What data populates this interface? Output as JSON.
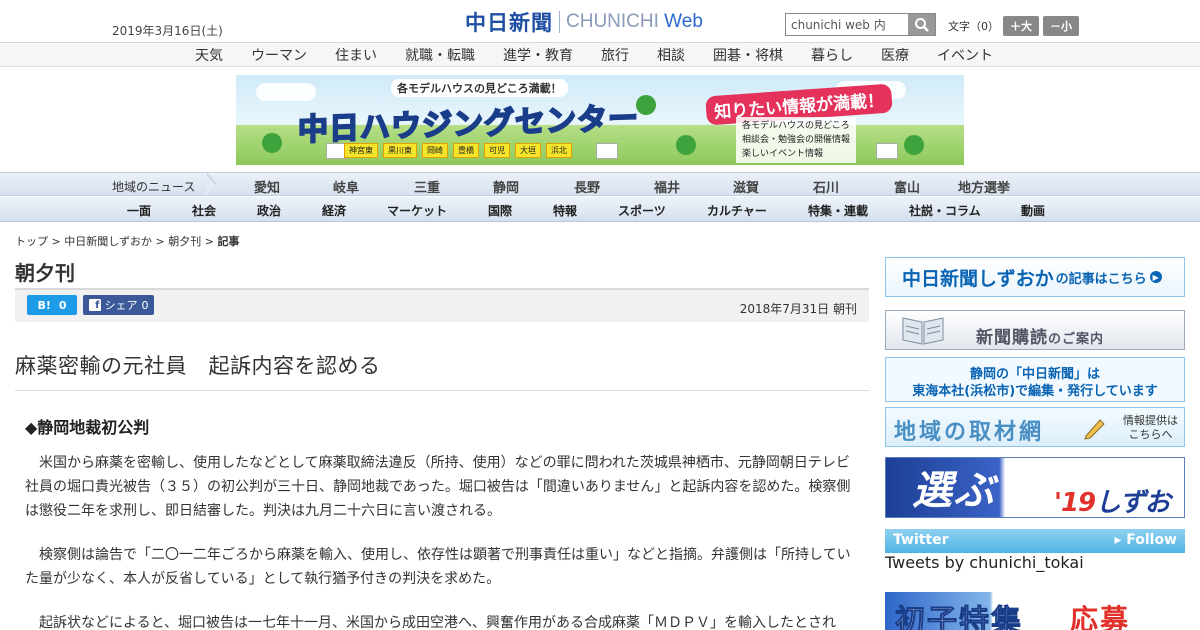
{
  "header": {
    "date": "2019年3月16日(土)",
    "logo_jp": "中日新聞",
    "logo_en": "CHUNICHI",
    "logo_web": "Web",
    "search_value": "chunichi web 内",
    "font_label": "文字（0）",
    "font_plus": "＋大",
    "font_minus": "－小"
  },
  "category_nav": [
    "天気",
    "ウーマン",
    "住まい",
    "就職・転職",
    "進学・教育",
    "旅行",
    "相談",
    "囲碁・将棋",
    "暮らし",
    "医療",
    "イベント"
  ],
  "banner": {
    "top_text": "各モデルハウスの見どころ満載！",
    "title": "中日ハウジングセンター",
    "right_text": "知りたい情報が満載！",
    "list": [
      "各モデルハウスの見どころ",
      "相談会・勉強会の開催情報",
      "楽しいイベント情報"
    ],
    "cities": [
      "神宮東",
      "黒川東",
      "岡崎",
      "豊橋",
      "可児",
      "大垣",
      "浜北"
    ]
  },
  "region_nav": {
    "label": "地域のニュース",
    "items": [
      "愛知",
      "岐阜",
      "三重",
      "静岡",
      "長野",
      "福井",
      "滋賀",
      "石川",
      "富山",
      "地方選挙"
    ]
  },
  "section_nav": [
    "一面",
    "社会",
    "政治",
    "経済",
    "マーケット",
    "国際",
    "特報",
    "スポーツ",
    "カルチャー",
    "特集・連載",
    "社説・コラム",
    "動画"
  ],
  "breadcrumb": {
    "items": [
      "トップ",
      "中日新聞しずおか",
      "朝夕刊"
    ],
    "current": "記事",
    "sep": " > "
  },
  "article": {
    "section_title": "朝夕刊",
    "hatena_label": "B!",
    "hatena_count": "0",
    "fb_label": "シェア",
    "fb_count": "0",
    "pub_date": "2018年7月31日 朝刊",
    "headline": "麻薬密輸の元社員　起訴内容を認める",
    "subhead": "◆静岡地裁初公判",
    "paragraphs": [
      "米国から麻薬を密輸し、使用したなどとして麻薬取締法違反（所持、使用）などの罪に問われた茨城県神栖市、元静岡朝日テレビ社員の堀口貴光被告（３５）の初公判が三十日、静岡地裁であった。堀口被告は「間違いありません」と起訴内容を認めた。検察側は懲役二年を求刑し、即日結審した。判決は九月二十六日に言い渡される。",
      "検察側は論告で「二〇一二年ごろから麻薬を輸入、使用し、依存性は顕著で刑事責任は重い」などと指摘。弁護側は「所持していた量が少なく、本人が反省している」として執行猶予付きの判決を求めた。",
      "起訴状などによると、堀口被告は一七年十一月、米国から成田空港へ、興奮作用がある合成麻薬「ＭＤＰＶ」を輸入したとされ"
    ]
  },
  "sidebar": {
    "shizuoka_main": "中日新聞しずおか",
    "shizuoka_tail": "の記事はこちら",
    "subscribe_main": "新聞購読",
    "subscribe_tail": "のご案内",
    "tokai_line1": "静岡の「中日新聞」は",
    "tokai_line2": "東海本社(浜松市)で編集・発行しています",
    "network_title": "地域の取材網",
    "network_sub1": "情報提供は",
    "network_sub2": "こちらへ",
    "election_big": "選ぶ",
    "election_year": "'19",
    "election_place": "しずおか",
    "twitter_label": "Twitter",
    "twitter_follow": "▸ Follow",
    "tweets_by": "Tweets by chunichi_tokai",
    "bottom_ad": "初子特集",
    "bottom_ad_red": "応募"
  }
}
